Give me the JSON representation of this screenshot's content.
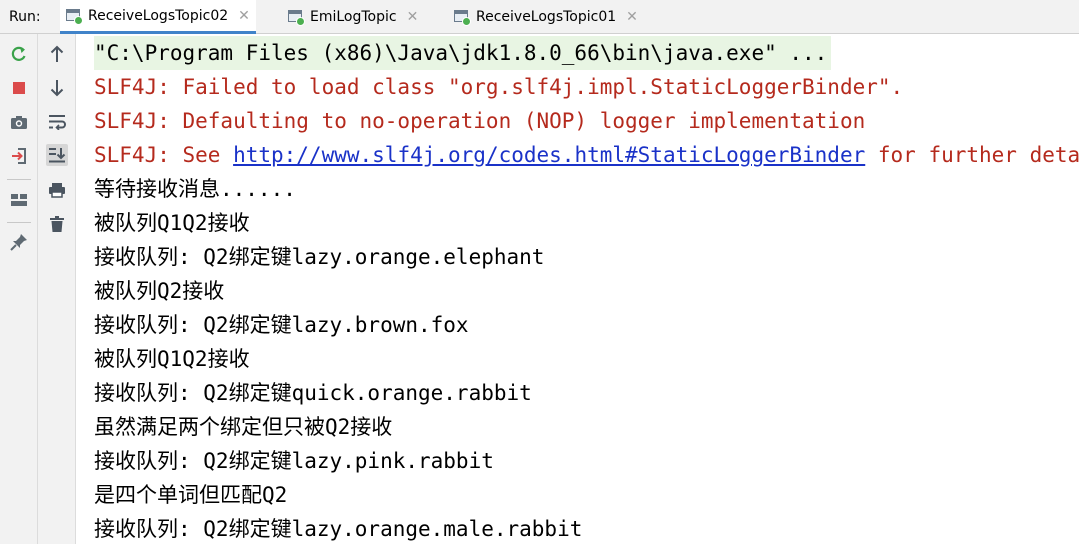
{
  "run_label": "Run:",
  "tabs": [
    {
      "label": "ReceiveLogsTopic02",
      "active": true
    },
    {
      "label": "EmiLogTopic",
      "active": false
    },
    {
      "label": "ReceiveLogsTopic01",
      "active": false
    }
  ],
  "toolbar": {
    "rerun_icon": "rerun-icon",
    "stop_icon": "stop-icon",
    "camera_icon": "camera-icon",
    "login_icon": "login-icon",
    "layout_icon": "layout-icon",
    "pin_icon": "pin-icon",
    "up_icon": "arrow-up-icon",
    "down_icon": "arrow-down-icon",
    "wrap_icon": "soft-wrap-icon",
    "scroll_end_icon": "scroll-to-end-icon",
    "print_icon": "print-icon",
    "trash_icon": "trash-icon"
  },
  "console": {
    "cmd": "\"C:\\Program Files (x86)\\Java\\jdk1.8.0_66\\bin\\java.exe\" ...",
    "err1": "SLF4J: Failed to load class \"org.slf4j.impl.StaticLoggerBinder\".",
    "err2": "SLF4J: Defaulting to no-operation (NOP) logger implementation",
    "err3_prefix": "SLF4J: See ",
    "err3_link": "http://www.slf4j.org/codes.html#StaticLoggerBinder",
    "err3_suffix": " for further details.",
    "out": [
      "等待接收消息......",
      "被队列Q1Q2接收",
      "接收队列: Q2绑定键lazy.orange.elephant",
      "被队列Q2接收",
      "接收队列: Q2绑定键lazy.brown.fox",
      "被队列Q1Q2接收",
      "接收队列: Q2绑定键quick.orange.rabbit",
      "虽然满足两个绑定但只被Q2接收",
      "接收队列: Q2绑定键lazy.pink.rabbit",
      "是四个单词但匹配Q2",
      "接收队列: Q2绑定键lazy.orange.male.rabbit"
    ]
  },
  "colors": {
    "error_text": "#b52a1d",
    "link": "#1a32c8",
    "cmd_bg": "#e8f5e3",
    "active_tab_underline": "#4083c9"
  }
}
